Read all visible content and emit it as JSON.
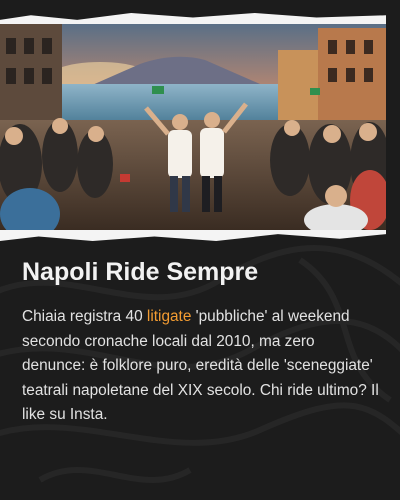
{
  "post": {
    "title": "Napoli Ride Sempre",
    "body_before": "Chiaia registra 40 ",
    "body_highlight": "litigate",
    "body_after": " 'pubbliche' al weekend secondo cronache locali dal 2010, ma zero denunce: è folklore puro, eredità delle 'sceneggiate' teatrali napoletane del XIX secolo. Chi ride ultimo? Il like su Insta."
  },
  "colors": {
    "background": "#1c1c1c",
    "title": "#f2f2f2",
    "body": "#e2e2e2",
    "highlight": "#f39c32"
  }
}
